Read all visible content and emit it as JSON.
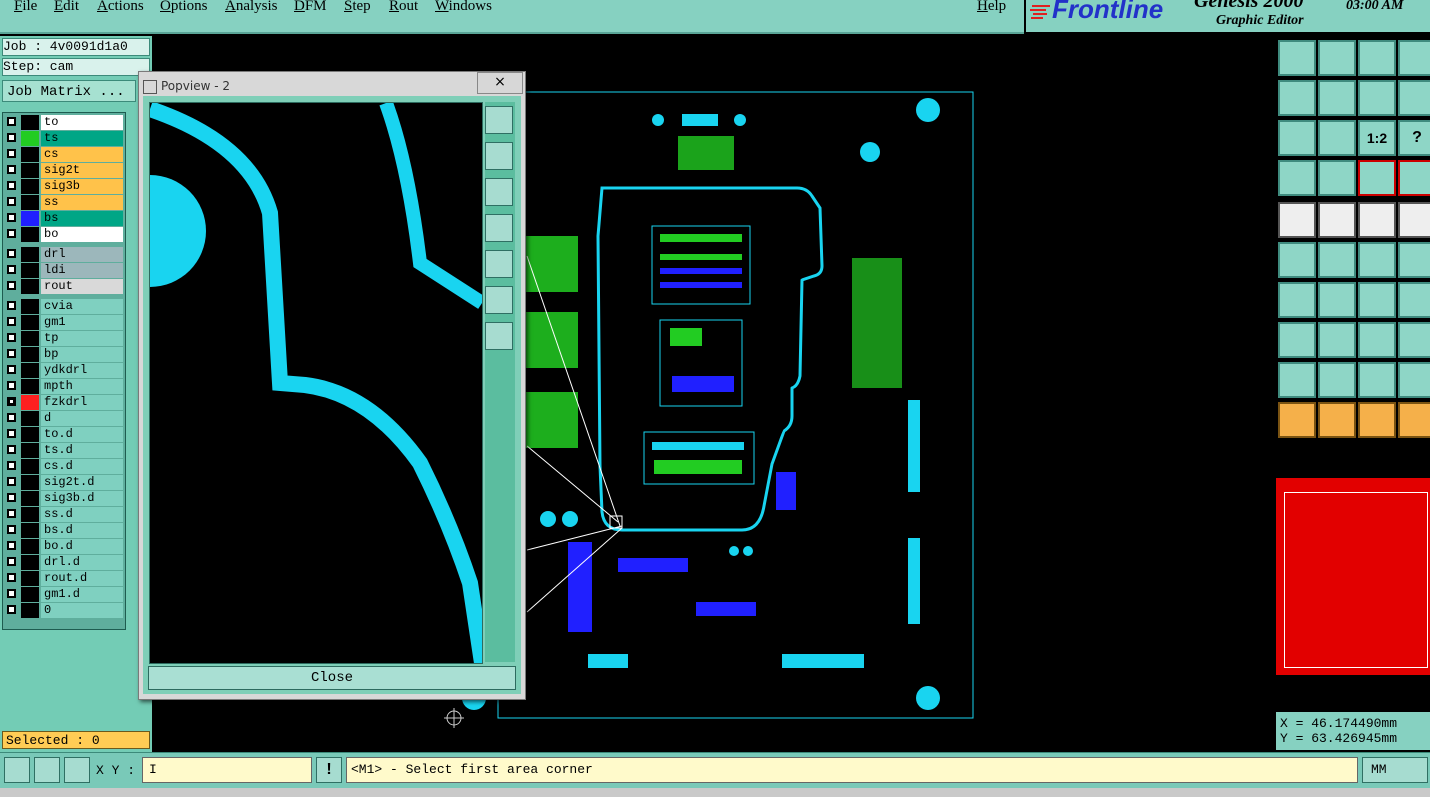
{
  "menu": [
    "File",
    "Edit",
    "Actions",
    "Options",
    "Analysis",
    "DFM",
    "Step",
    "Rout",
    "Windows"
  ],
  "help": "Help",
  "brand": {
    "logo": "Frontline",
    "product": "Genesis 2000",
    "subtitle": "Graphic Editor",
    "time": "03:00 AM"
  },
  "job": {
    "job_label": "Job : 4v0091d1a0",
    "step_label": "Step: cam",
    "matrix_button": "Job Matrix ..."
  },
  "layers": [
    {
      "name": "to",
      "color": "#000000",
      "bg": "#ffffff",
      "active": false
    },
    {
      "name": "ts",
      "color": "#22cc22",
      "bg": "#00a686",
      "active": false
    },
    {
      "name": "cs",
      "color": "#000000",
      "bg": "#ffc24a",
      "active": false
    },
    {
      "name": "sig2t",
      "color": "#000000",
      "bg": "#ffc24a",
      "active": false
    },
    {
      "name": "sig3b",
      "color": "#000000",
      "bg": "#ffc24a",
      "active": false
    },
    {
      "name": "ss",
      "color": "#000000",
      "bg": "#ffc24a",
      "active": false
    },
    {
      "name": "bs",
      "color": "#2020ff",
      "bg": "#00a686",
      "active": false
    },
    {
      "name": "bo",
      "color": "#000000",
      "bg": "#ffffff",
      "active": false
    },
    {
      "name": "drl",
      "color": "#000000",
      "bg": "#9cb7bb",
      "active": false
    },
    {
      "name": "ldi",
      "color": "#000000",
      "bg": "#9cb7bb",
      "active": false
    },
    {
      "name": "rout",
      "color": "#000000",
      "bg": "#d9d9d9",
      "active": false
    },
    {
      "name": "cvia",
      "color": "#000000",
      "bg": "#7fd0c0",
      "active": false
    },
    {
      "name": "gm1",
      "color": "#000000",
      "bg": "#7fd0c0",
      "active": false
    },
    {
      "name": "tp",
      "color": "#000000",
      "bg": "#7fd0c0",
      "active": false
    },
    {
      "name": "bp",
      "color": "#000000",
      "bg": "#7fd0c0",
      "active": false
    },
    {
      "name": "ydkdrl",
      "color": "#000000",
      "bg": "#7fd0c0",
      "active": false
    },
    {
      "name": "mpth",
      "color": "#000000",
      "bg": "#7fd0c0",
      "active": false
    },
    {
      "name": "fzkdrl",
      "color": "#ff2020",
      "bg": "#7fd0c0",
      "active": true
    },
    {
      "name": "d",
      "color": "#000000",
      "bg": "#7fd0c0",
      "active": false
    },
    {
      "name": "to.d",
      "color": "#000000",
      "bg": "#7fd0c0",
      "active": false
    },
    {
      "name": "ts.d",
      "color": "#000000",
      "bg": "#7fd0c0",
      "active": false
    },
    {
      "name": "cs.d",
      "color": "#000000",
      "bg": "#7fd0c0",
      "active": false
    },
    {
      "name": "sig2t.d",
      "color": "#000000",
      "bg": "#7fd0c0",
      "active": false
    },
    {
      "name": "sig3b.d",
      "color": "#000000",
      "bg": "#7fd0c0",
      "active": false
    },
    {
      "name": "ss.d",
      "color": "#000000",
      "bg": "#7fd0c0",
      "active": false
    },
    {
      "name": "bs.d",
      "color": "#000000",
      "bg": "#7fd0c0",
      "active": false
    },
    {
      "name": "bo.d",
      "color": "#000000",
      "bg": "#7fd0c0",
      "active": false
    },
    {
      "name": "drl.d",
      "color": "#000000",
      "bg": "#7fd0c0",
      "active": false
    },
    {
      "name": "rout.d",
      "color": "#000000",
      "bg": "#7fd0c0",
      "active": false
    },
    {
      "name": "gm1.d",
      "color": "#000000",
      "bg": "#7fd0c0",
      "active": false
    },
    {
      "name": "0",
      "color": "#000000",
      "bg": "#7fd0c0",
      "active": false
    }
  ],
  "selected_label": "Selected : 0",
  "popview": {
    "title": "Popview - 2",
    "close_x": "×",
    "close_button": "Close"
  },
  "right_toolbar": {
    "row_labels": [
      "1:2",
      "?"
    ]
  },
  "coords": {
    "x": "X =  46.174490mm",
    "y": "Y =  63.426945mm"
  },
  "status": {
    "xy_label": "X Y :",
    "xy_value": "I",
    "prompt": "<M1> - Select first area corner",
    "units": "MM"
  },
  "colors": {
    "trace": "#19d4f0",
    "copper_green": "#22cc22",
    "pad_blue": "#2020ff",
    "panel": "#86d1c1"
  }
}
